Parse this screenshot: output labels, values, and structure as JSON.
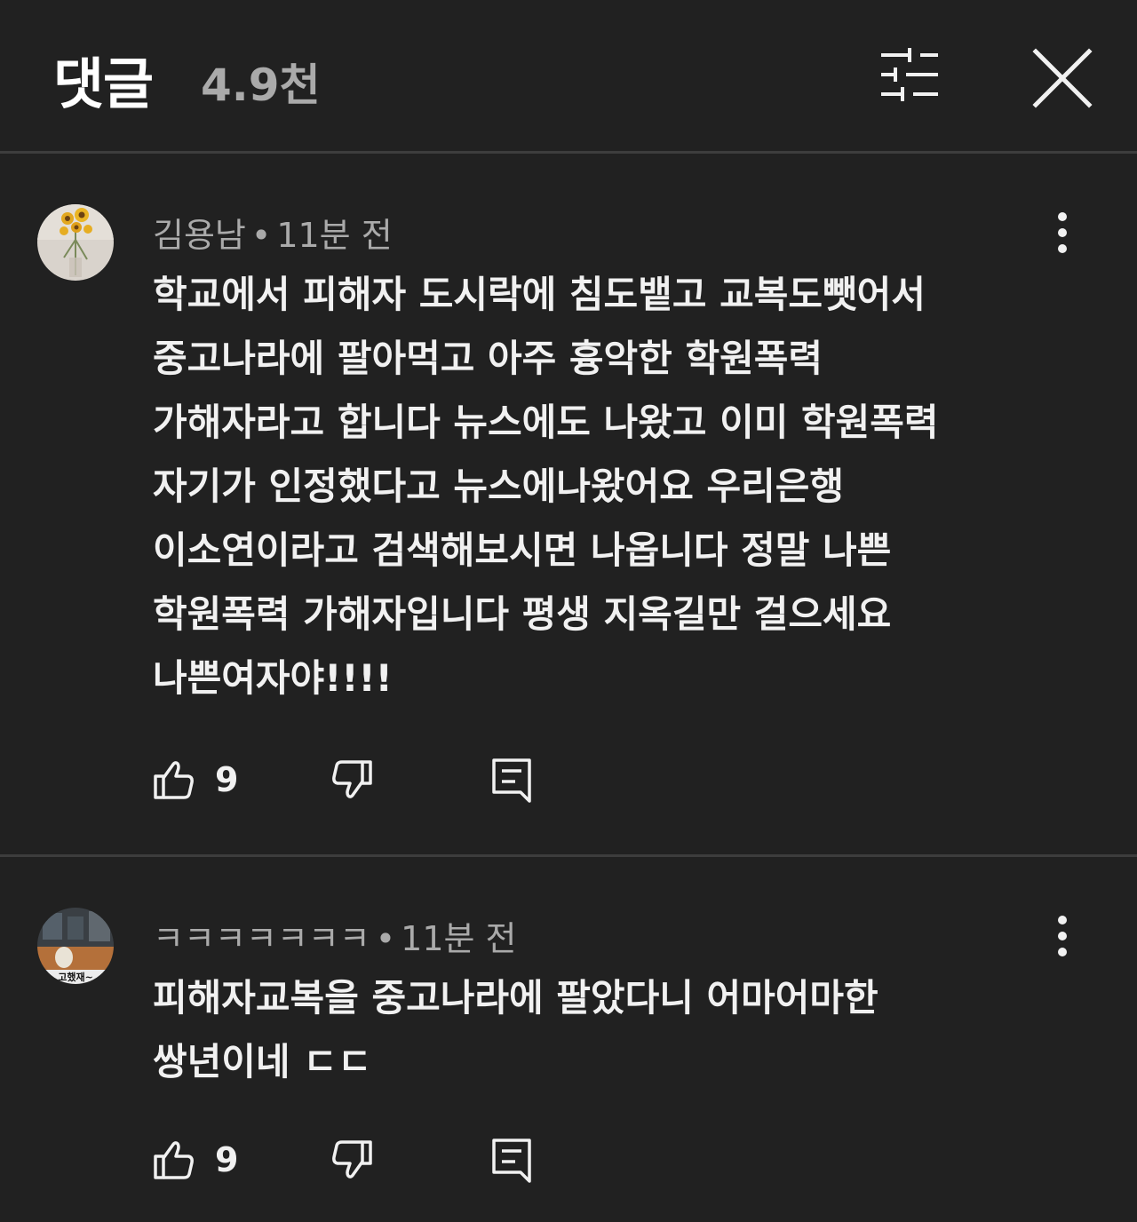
{
  "header": {
    "title": "댓글",
    "count": "4.9천",
    "filter_icon": "sort-filter-icon",
    "close_icon": "close-icon"
  },
  "comments": [
    {
      "author": "김용남",
      "separator": "•",
      "time": "11분 전",
      "text": "학교에서 피해자 도시락에 침도뱉고 교복도뺏어서\n중고나라에 팔아먹고 아주 흉악한 학원폭력\n가해자라고 합니다 뉴스에도 나왔고 이미 학원폭력\n자기가 인정했다고 뉴스에나왔어요 우리은행\n이소연이라고 검색해보시면 나옵니다 정말 나쁜\n학원폭력 가해자입니다 평생 지옥길만 걸으세요\n나쁜여자야!!!!",
      "likes": "9",
      "avatar_icon": "sunflower-avatar"
    },
    {
      "author": "ㅋㅋㅋㅋㅋㅋㅋ",
      "separator": "•",
      "time": "11분 전",
      "text": "피해자교복을 중고나라에 팔았다니 어마어마한\n쌍년이네 ㄷㄷ",
      "likes": "9",
      "avatar_icon": "photo-avatar",
      "avatar_caption": "고했재~"
    }
  ],
  "colors": {
    "background": "#212121",
    "text": "#f1f1f1",
    "secondary_text": "#aaaaaa",
    "divider": "#3d3d3d"
  }
}
